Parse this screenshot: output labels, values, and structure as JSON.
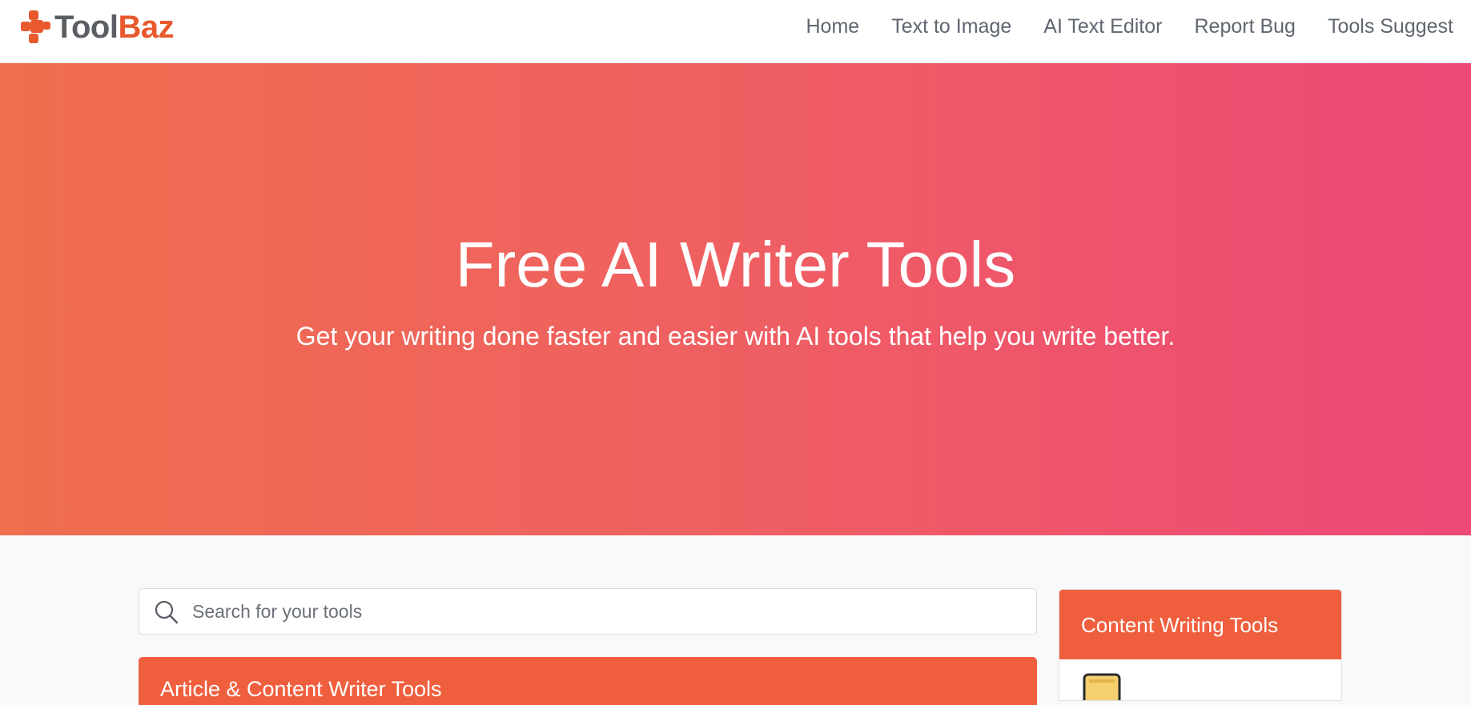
{
  "brand": {
    "name_part1": "Tool",
    "name_part2": "Baz",
    "primary_color": "#e8592d"
  },
  "nav": {
    "links": [
      {
        "label": "Home"
      },
      {
        "label": "Text to Image"
      },
      {
        "label": "AI Text Editor"
      },
      {
        "label": "Report Bug"
      },
      {
        "label": "Tools Suggest"
      }
    ]
  },
  "hero": {
    "title": "Free AI Writer Tools",
    "subtitle": "Get your writing done faster and easier with AI tools that help you write better.",
    "gradient_colors": [
      "#ef6e4e",
      "#ee4877"
    ]
  },
  "search": {
    "placeholder": "Search for your tools",
    "value": "",
    "icon": "search-icon"
  },
  "main": {
    "section_title": "Article & Content Writer Tools",
    "accent_color": "#ef5f3e"
  },
  "sidebar": {
    "card_title": "Content Writing Tools",
    "first_item_icon": "notepad-icon"
  }
}
